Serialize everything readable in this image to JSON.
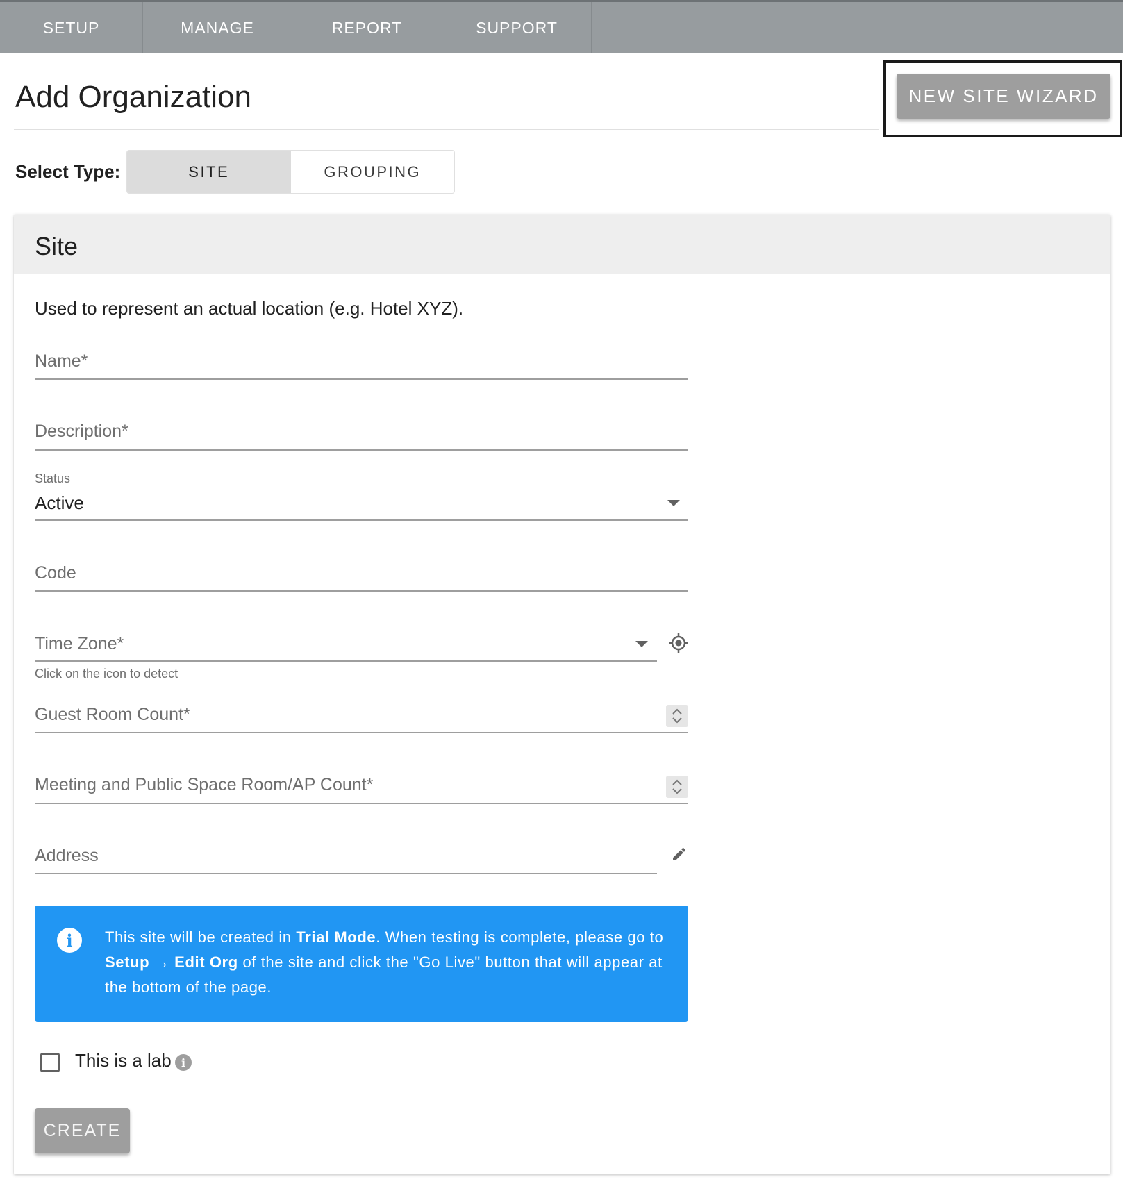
{
  "nav": {
    "items": [
      {
        "label": "SETUP"
      },
      {
        "label": "MANAGE"
      },
      {
        "label": "REPORT"
      },
      {
        "label": "SUPPORT"
      }
    ]
  },
  "header": {
    "title": "Add Organization",
    "wizard_button": "NEW SITE WIZARD"
  },
  "select_type": {
    "label": "Select Type:",
    "options": [
      {
        "label": "SITE",
        "active": true
      },
      {
        "label": "GROUPING",
        "active": false
      }
    ]
  },
  "card": {
    "title": "Site",
    "description": "Used to represent an actual location (e.g. Hotel XYZ).",
    "fields": {
      "name": {
        "label": "Name*"
      },
      "description": {
        "label": "Description*"
      },
      "status": {
        "label": "Status",
        "value": "Active"
      },
      "code": {
        "label": "Code"
      },
      "time_zone": {
        "label": "Time Zone*",
        "hint": "Click on the icon to detect"
      },
      "guest_room_count": {
        "label": "Guest Room Count*"
      },
      "meeting_space_count": {
        "label": "Meeting and Public Space Room/AP Count*"
      },
      "address": {
        "label": "Address"
      }
    },
    "info_banner": {
      "icon": "info-icon",
      "text_1": "This site will be created in ",
      "bold_1": "Trial Mode",
      "text_2": ". When testing is complete, please go to ",
      "bold_2": "Setup",
      "arrow": "→",
      "bold_3": "Edit Org",
      "text_3": " of the site and click the \"Go Live\" button that will appear at the bottom of the page."
    },
    "lab_checkbox": {
      "label": "This is a lab",
      "checked": false
    },
    "create_button": "CREATE"
  },
  "colors": {
    "nav_bg": "#979c9f",
    "button_gray": "#9e9e9e",
    "info_blue": "#2196f3"
  }
}
